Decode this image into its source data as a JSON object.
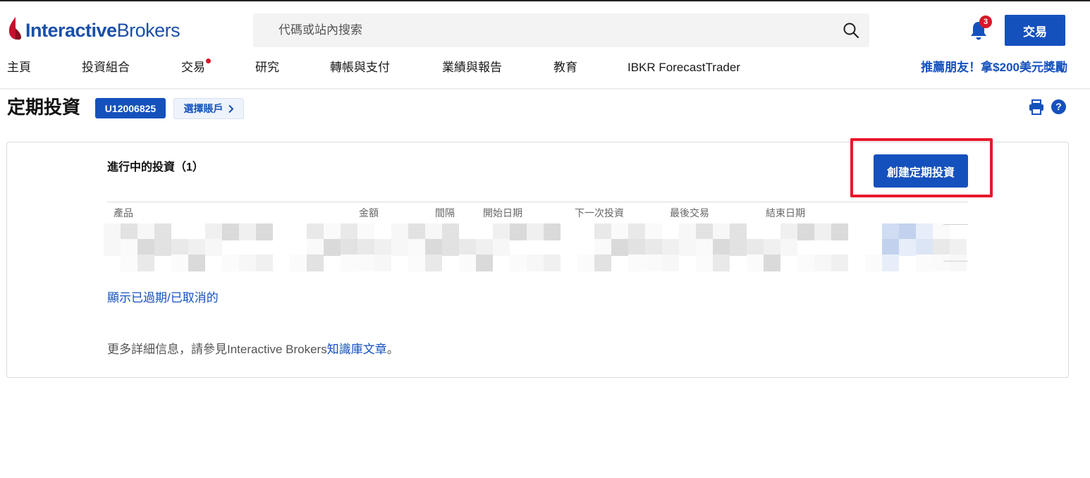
{
  "header": {
    "logo": {
      "brand_bold": "Interactive",
      "brand_light": "Brokers",
      "mark_icon": "ib-logo-flame"
    },
    "search": {
      "placeholder": "代碼或站內搜索",
      "icon": "search-icon"
    },
    "notifications": {
      "icon": "bell-icon",
      "count": "3"
    },
    "trade_button": "交易",
    "referral": "推薦朋友！拿$200美元獎勵"
  },
  "nav": {
    "items": [
      {
        "label": "主頁"
      },
      {
        "label": "投資組合"
      },
      {
        "label": "交易",
        "has_alert_dot": true
      },
      {
        "label": "研究"
      },
      {
        "label": "轉帳與支付"
      },
      {
        "label": "業績與報告"
      },
      {
        "label": "教育"
      },
      {
        "label": "IBKR ForecastTrader"
      }
    ]
  },
  "page": {
    "title": "定期投資",
    "account_id": "U12006825",
    "select_account": "選擇賬戶",
    "print_icon": "printer-icon",
    "help_icon": "help-icon"
  },
  "card": {
    "section_title": "進行中的投資（1）",
    "create_button": "創建定期投資",
    "columns": [
      "產品",
      "金額",
      "間隔",
      "開始日期",
      "下一次投資",
      "最後交易",
      "結束日期"
    ],
    "rows_redacted": true,
    "show_expired_link": "顯示已過期/已取消的",
    "footnote": {
      "prefix": "更多詳細信息，請參見Interactive Brokers",
      "link": "知識庫文章",
      "suffix": "。"
    }
  },
  "colors": {
    "brand_blue": "#1551bd",
    "alert_red": "#d7192a",
    "highlight_red": "#e8182c"
  }
}
